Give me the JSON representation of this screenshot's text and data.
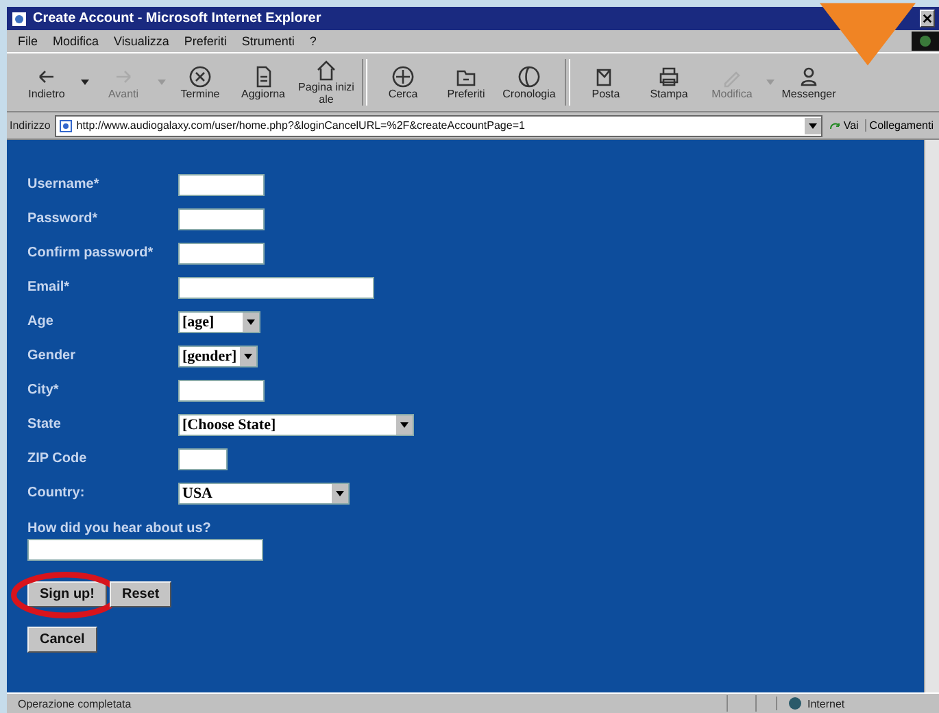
{
  "window": {
    "title": "Create Account - Microsoft Internet Explorer"
  },
  "menu": [
    "File",
    "Modifica",
    "Visualizza",
    "Preferiti",
    "Strumenti",
    "?"
  ],
  "toolbar": [
    {
      "label": "Indietro",
      "disabled": false,
      "dropdown": true
    },
    {
      "label": "Avanti",
      "disabled": true,
      "dropdown": true
    },
    {
      "label": "Termine",
      "disabled": false,
      "dropdown": false
    },
    {
      "label": "Aggiorna",
      "disabled": false,
      "dropdown": false
    },
    {
      "label": "Pagina iniziale",
      "disabled": false,
      "dropdown": false
    },
    {
      "label": "Cerca",
      "disabled": false,
      "dropdown": false
    },
    {
      "label": "Preferiti",
      "disabled": false,
      "dropdown": false
    },
    {
      "label": "Cronologia",
      "disabled": false,
      "dropdown": false
    },
    {
      "label": "Posta",
      "disabled": false,
      "dropdown": false
    },
    {
      "label": "Stampa",
      "disabled": false,
      "dropdown": false
    },
    {
      "label": "Modifica",
      "disabled": true,
      "dropdown": true
    },
    {
      "label": "Messenger",
      "disabled": false,
      "dropdown": false
    }
  ],
  "address": {
    "label": "Indirizzo",
    "url": "http://www.audiogalaxy.com/user/home.php?&loginCancelURL=%2F&createAccountPage=1",
    "go": "Vai",
    "links": "Collegamenti"
  },
  "form": {
    "fields": [
      {
        "label": "Username*",
        "kind": "text"
      },
      {
        "label": "Password*",
        "kind": "text"
      },
      {
        "label": "Confirm password*",
        "kind": "text"
      },
      {
        "label": "Email*",
        "kind": "text"
      },
      {
        "label": "Age",
        "kind": "select",
        "value": "[age]"
      },
      {
        "label": "Gender",
        "kind": "select",
        "value": "[gender]"
      },
      {
        "label": "City*",
        "kind": "text"
      },
      {
        "label": "State",
        "kind": "select",
        "value": "[Choose State]"
      },
      {
        "label": "ZIP Code",
        "kind": "text"
      },
      {
        "label": "Country:",
        "kind": "select",
        "value": "USA"
      }
    ],
    "question": "How did you hear about us?",
    "buttons": [
      {
        "label": "Sign up!",
        "highlighted": true
      },
      {
        "label": "Reset",
        "highlighted": false
      }
    ],
    "cancel": "Cancel"
  },
  "status_bar": {
    "text": "Operazione completata",
    "zone": "Internet"
  }
}
